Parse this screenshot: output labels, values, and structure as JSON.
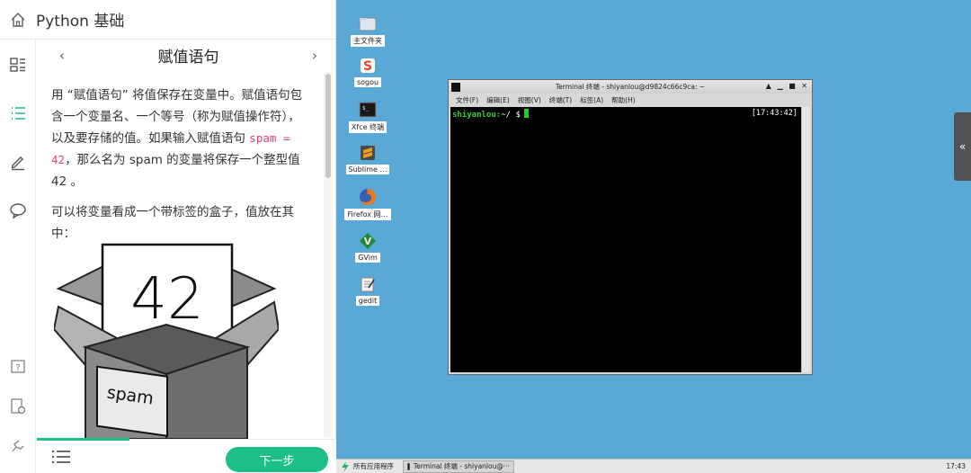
{
  "course": {
    "title": "Python 基础"
  },
  "lesson": {
    "title": "赋值语句",
    "prev_label": "‹",
    "next_label": "›",
    "p1_a": "用 “赋值语句” 将值保存在变量中。赋值语句包含一个变量名、一个等号（称为赋值操作符），以及要存储的值。如果输入赋值语句 ",
    "p1_code": "spam = 42",
    "p1_b": "，那么名为 spam 的变量将保存一个整型值 42 。",
    "p2": "可以将变量看成一个带标签的盒子，值放在其中：",
    "box_value": "42",
    "box_label": "spam"
  },
  "bottom": {
    "next_button": "下一步",
    "progress_fraction": 0.31
  },
  "rail": [
    "home-icon",
    "document-icon",
    "list-icon",
    "pencil-icon",
    "chat-icon",
    "help-icon",
    "report-icon",
    "settings-icon"
  ],
  "desktop": {
    "icons": [
      {
        "label": "主文件夹",
        "icon": "folder-icon"
      },
      {
        "label": "sogou",
        "icon": "sogou-icon"
      },
      {
        "label": "Xfce 终端",
        "icon": "terminal-icon"
      },
      {
        "label": "Sublime …",
        "icon": "sublime-icon"
      },
      {
        "label": "Firefox 网…",
        "icon": "firefox-icon"
      },
      {
        "label": "GVim",
        "icon": "gvim-icon"
      },
      {
        "label": "gedit",
        "icon": "gedit-icon"
      }
    ],
    "collapse_label": "«"
  },
  "terminal": {
    "title": "Terminal 终端 - shiyanlou@d9824c66c9ca: ~",
    "controls": "▲ ▁ ■ ✕",
    "menu": [
      "文件(F)",
      "编辑(E)",
      "视图(V)",
      "终端(T)",
      "标签(A)",
      "帮助(H)"
    ],
    "prompt_user": "shiyanlou:",
    "prompt_path": "~/ $",
    "clock": "[17:43:42]"
  },
  "taskbar": {
    "apps_label": "所有应用程序",
    "task_label": "Terminal 终端 - shiyanlou@···",
    "clock": "17:43"
  },
  "colors": {
    "accent": "#1cbf85",
    "desktop": "#5aa8d6",
    "code": "#e0407a"
  }
}
